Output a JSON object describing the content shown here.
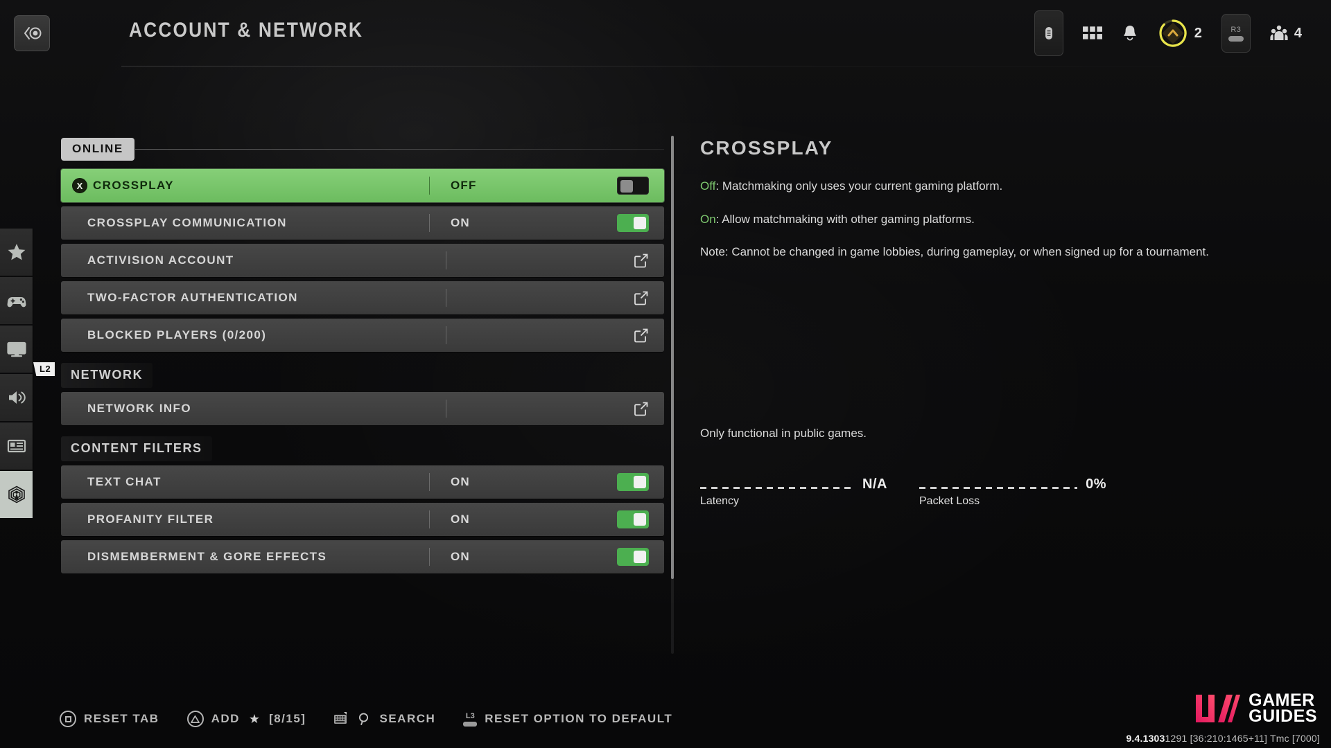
{
  "header": {
    "title": "ACCOUNT & NETWORK",
    "back_icon": "back-circle-icon",
    "right_items": [
      {
        "icon": "touchpad-pill-icon",
        "label": ""
      },
      {
        "icon": "grid-menu-icon",
        "label": ""
      },
      {
        "icon": "bell-notification-icon",
        "label": ""
      },
      {
        "icon": "battlepass-rank-icon",
        "label": "2"
      },
      {
        "icon": "r3-stick-button",
        "label": "R3"
      },
      {
        "icon": "social-players-icon",
        "label": "4"
      }
    ]
  },
  "sidebar": {
    "l2_hint": "L2",
    "items": [
      {
        "icon": "star-icon",
        "name": "favorites"
      },
      {
        "icon": "gamepad-icon",
        "name": "controller"
      },
      {
        "icon": "monitor-graphics-icon",
        "name": "graphics"
      },
      {
        "icon": "speaker-audio-icon",
        "name": "audio"
      },
      {
        "icon": "interface-layout-icon",
        "name": "interface"
      },
      {
        "icon": "network-broadcast-icon",
        "name": "account-network",
        "active": true
      }
    ]
  },
  "settings": {
    "tab": "ONLINE",
    "sections": [
      {
        "header": null,
        "rows": [
          {
            "label": "CROSSPLAY",
            "value": "OFF",
            "control": "toggle",
            "toggle_state": "off",
            "selected": true,
            "button_hint": "X"
          },
          {
            "label": "CROSSPLAY COMMUNICATION",
            "value": "ON",
            "control": "toggle",
            "toggle_state": "on",
            "selected": false
          },
          {
            "label": "ACTIVISION ACCOUNT",
            "value": "",
            "control": "external-link",
            "selected": false
          },
          {
            "label": "TWO-FACTOR AUTHENTICATION",
            "value": "",
            "control": "external-link",
            "selected": false
          },
          {
            "label": "BLOCKED PLAYERS (0/200)",
            "value": "",
            "control": "external-link",
            "selected": false
          }
        ]
      },
      {
        "header": "NETWORK",
        "rows": [
          {
            "label": "NETWORK INFO",
            "value": "",
            "control": "external-link",
            "selected": false
          }
        ]
      },
      {
        "header": "CONTENT FILTERS",
        "rows": [
          {
            "label": "TEXT CHAT",
            "value": "ON",
            "control": "toggle",
            "toggle_state": "on",
            "selected": false
          },
          {
            "label": "PROFANITY FILTER",
            "value": "ON",
            "control": "toggle",
            "toggle_state": "on",
            "selected": false
          },
          {
            "label": "DISMEMBERMENT & GORE EFFECTS",
            "value": "ON",
            "control": "toggle",
            "toggle_state": "on",
            "selected": false
          }
        ]
      }
    ]
  },
  "detail": {
    "title": "CROSSPLAY",
    "paragraphs": [
      {
        "lead": "Off",
        "text": ": Matchmaking only uses your current gaming platform."
      },
      {
        "lead": "On",
        "text": ": Allow matchmaking with other gaming platforms."
      },
      {
        "lead": "",
        "text": "Note: Cannot be changed in game lobbies, during gameplay, or when signed up for a tournament."
      }
    ],
    "note": "Only functional in public games.",
    "meters": [
      {
        "label": "Latency",
        "value": "N/A"
      },
      {
        "label": "Packet Loss",
        "value": "0%"
      }
    ]
  },
  "bottom_bar": {
    "items": [
      {
        "icon": "square-button-icon",
        "label": "RESET TAB"
      },
      {
        "icon": "triangle-button-icon",
        "label": "ADD",
        "star": "★",
        "count": "[8/15]"
      },
      {
        "icon": "keyboard-search-icon",
        "label": "SEARCH"
      },
      {
        "icon": "l3-stick-icon",
        "label": "RESET OPTION TO DEFAULT"
      }
    ]
  },
  "watermark": {
    "brand_line1": "GAMER",
    "brand_line2": "GUIDES",
    "build_bold": "9.4.1303",
    "build_rest": "1291 [36:210:1465+11] Tmc [7000]"
  },
  "colors": {
    "accent_green": "#6cbc5f",
    "toggle_on": "#4caf50",
    "brand_pink": "#f2246b",
    "rank_yellow": "#e8e44a"
  }
}
